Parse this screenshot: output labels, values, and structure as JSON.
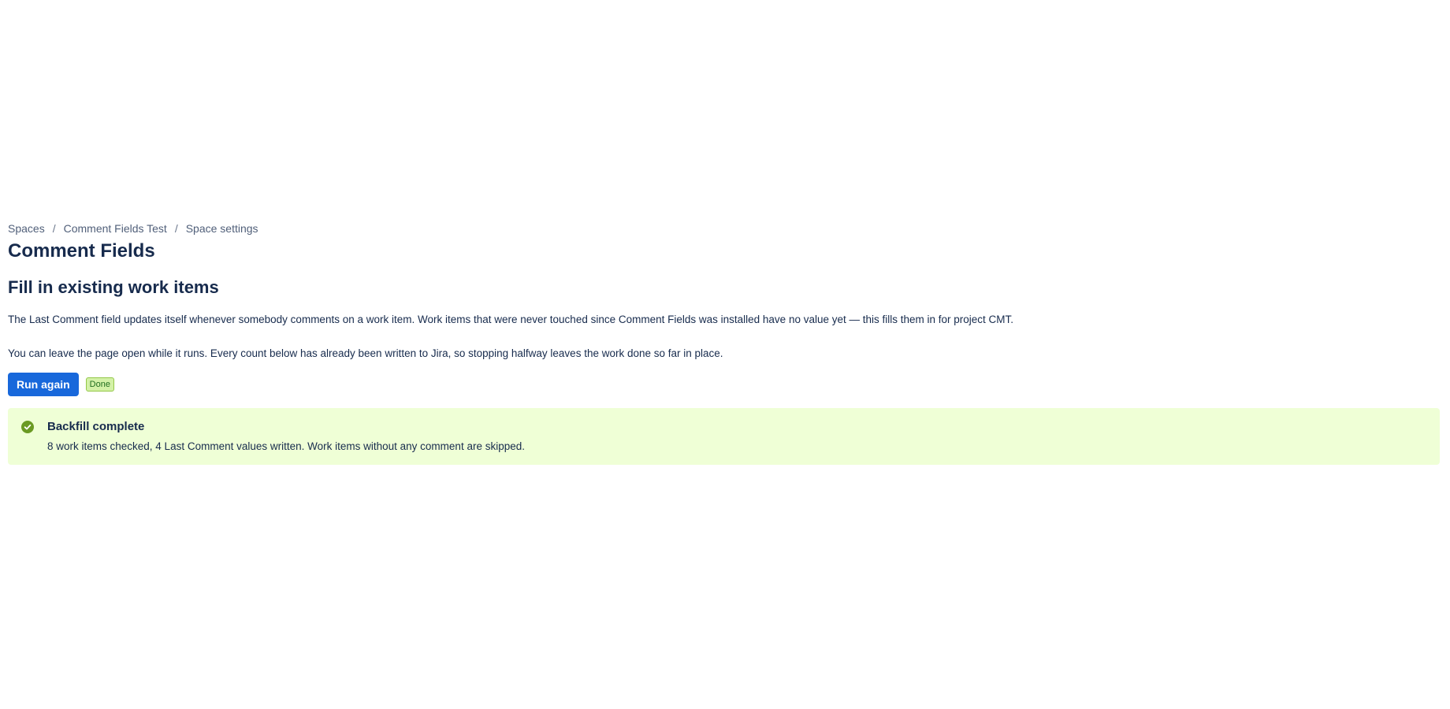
{
  "breadcrumb": {
    "items": [
      "Spaces",
      "Comment Fields Test",
      "Space settings"
    ],
    "separator": "/"
  },
  "header": {
    "title": "Comment Fields"
  },
  "main": {
    "section_title": "Fill in existing work items",
    "paragraph_1": "The Last Comment field updates itself whenever somebody comments on a work item. Work items that were never touched since Comment Fields was installed have no value yet — this fills them in for project CMT.",
    "paragraph_2": "You can leave the page open while it runs. Every count below has already been written to Jira, so stopping halfway leaves the work done so far in place.",
    "run_button_label": "Run again",
    "status_lozenge": "Done"
  },
  "banner": {
    "icon": "check-circle-icon",
    "title": "Backfill complete",
    "message": "8 work items checked, 4 Last Comment values written. Work items without any comment are skipped."
  },
  "colors": {
    "primary": "#1868db",
    "success_bg": "#efffd6",
    "success_icon": "#6a9a23",
    "lozenge_bg": "#d3f1a7"
  }
}
